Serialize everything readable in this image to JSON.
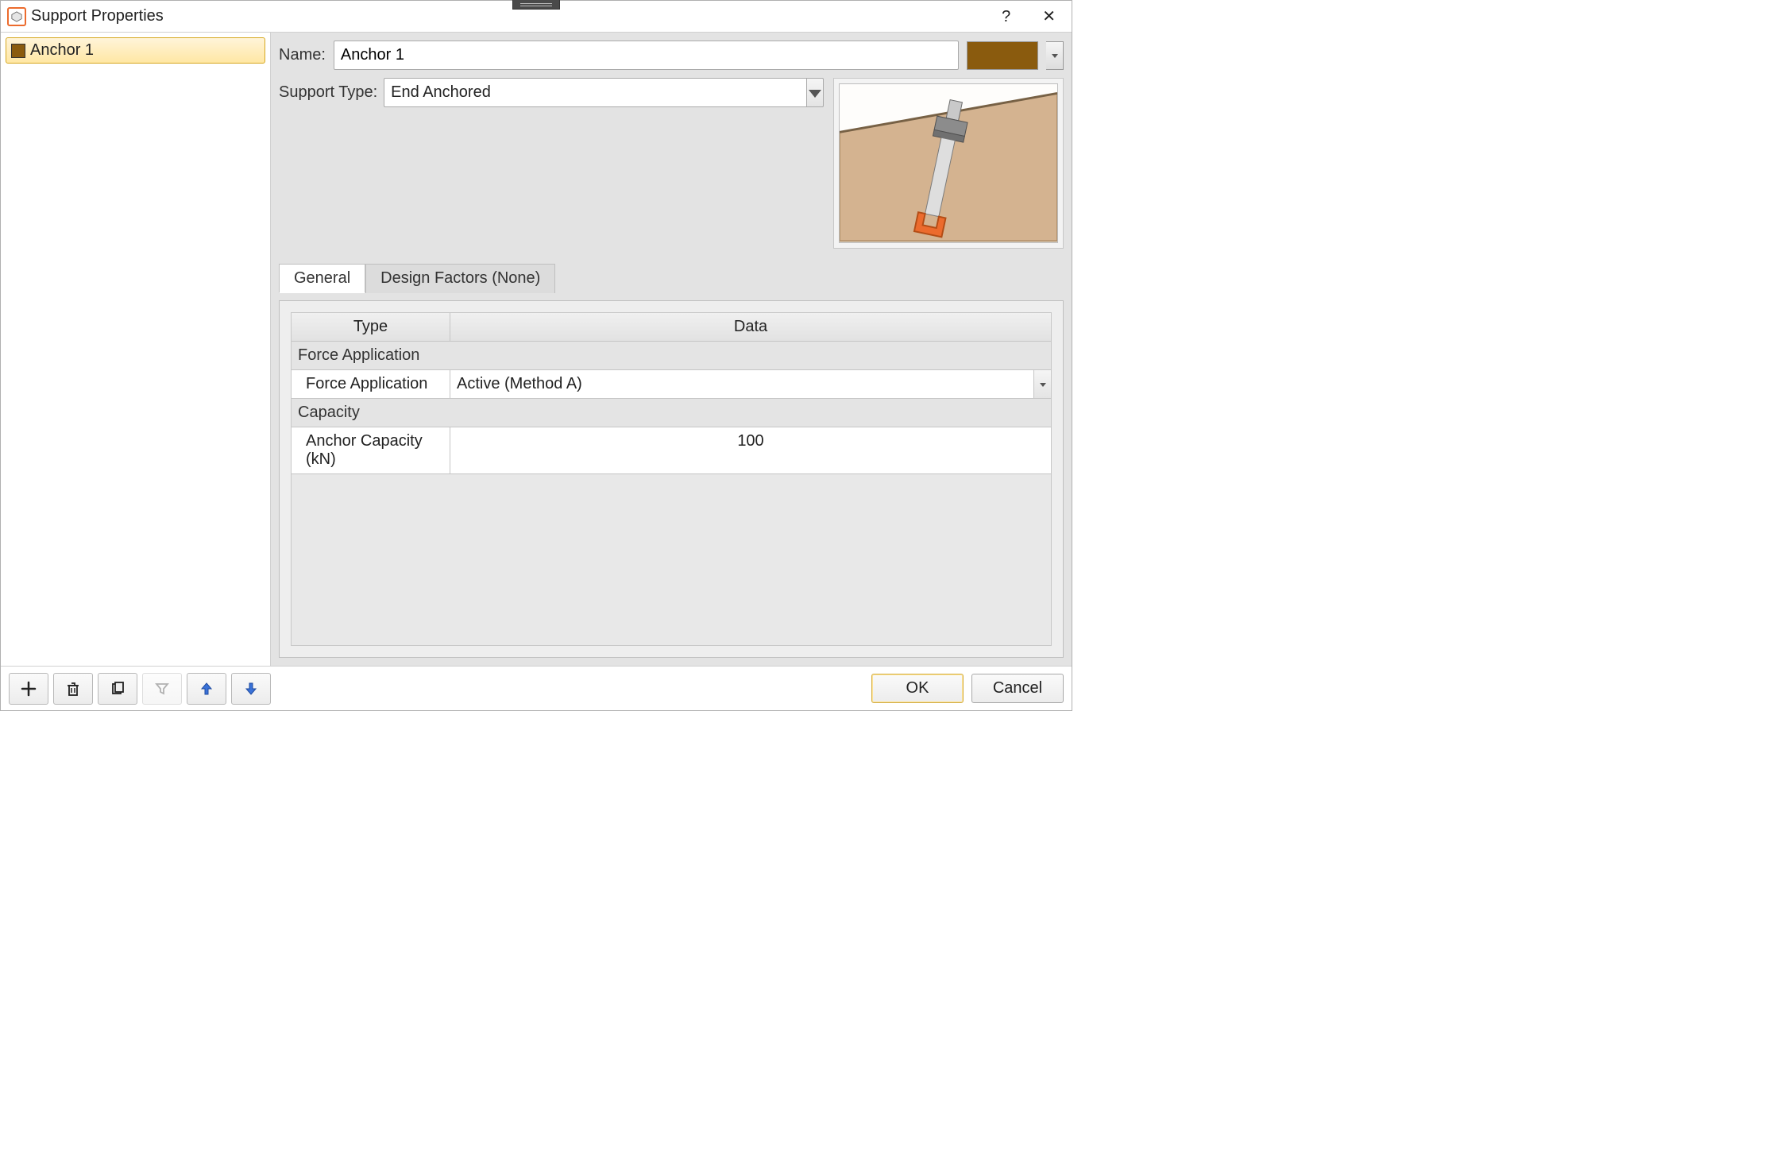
{
  "title": "Support Properties",
  "sidebar": {
    "items": [
      {
        "label": "Anchor 1",
        "color": "#8a5b0e"
      }
    ]
  },
  "name_label": "Name:",
  "name_value": "Anchor 1",
  "support_type_label": "Support Type:",
  "support_type_value": "End Anchored",
  "tabs": [
    {
      "label": "General"
    },
    {
      "label": "Design Factors (None)"
    }
  ],
  "table": {
    "headers": {
      "type": "Type",
      "data": "Data"
    },
    "sections": [
      {
        "title": "Force Application",
        "rows": [
          {
            "type": "Force Application",
            "data": "Active (Method A)",
            "kind": "dropdown"
          }
        ]
      },
      {
        "title": "Capacity",
        "rows": [
          {
            "type": "Anchor Capacity (kN)",
            "data": "100",
            "kind": "value"
          }
        ]
      }
    ]
  },
  "buttons": {
    "ok": "OK",
    "cancel": "Cancel"
  },
  "color_swatch": "#8a5b0e"
}
